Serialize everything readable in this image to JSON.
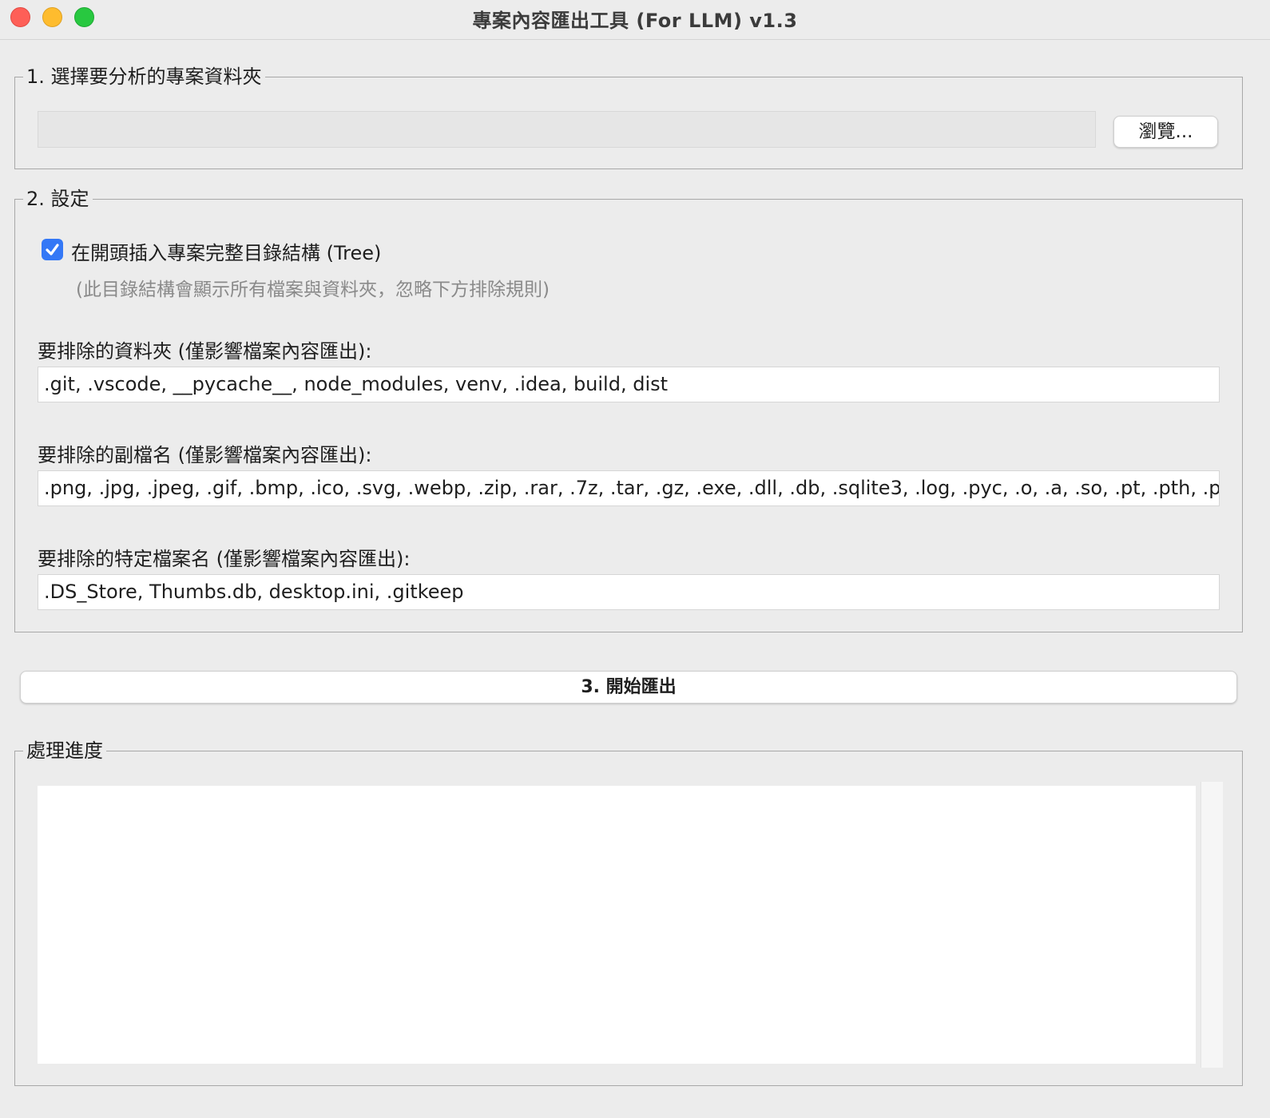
{
  "window": {
    "title": "專案內容匯出工具 (For LLM) v1.3"
  },
  "section1": {
    "legend": "1. 選擇要分析的專案資料夾",
    "path_value": "",
    "browse_label": "瀏覽..."
  },
  "section2": {
    "legend": "2. 設定",
    "tree_checkbox": {
      "checked": true,
      "label": "在開頭插入專案完整目錄結構 (Tree)",
      "hint": "(此目錄結構會顯示所有檔案與資料夾，忽略下方排除規則)"
    },
    "exclude_dirs": {
      "label": "要排除的資料夾 (僅影響檔案內容匯出):",
      "value": ".git, .vscode, __pycache__, node_modules, venv, .idea, build, dist"
    },
    "exclude_exts": {
      "label": "要排除的副檔名 (僅影響檔案內容匯出):",
      "value": ".png, .jpg, .jpeg, .gif, .bmp, .ico, .svg, .webp, .zip, .rar, .7z, .tar, .gz, .exe, .dll, .db, .sqlite3, .log, .pyc, .o, .a, .so, .pt, .pth, .pkl"
    },
    "exclude_files": {
      "label": "要排除的特定檔案名 (僅影響檔案內容匯出):",
      "value": ".DS_Store, Thumbs.db, desktop.ini, .gitkeep"
    }
  },
  "export_button": {
    "label": "3. 開始匯出"
  },
  "progress": {
    "legend": "處理進度",
    "log_text": ""
  },
  "colors": {
    "accent": "#3478f6",
    "window_bg": "#ececec",
    "close": "#fe5f57",
    "minimize": "#febc2e",
    "maximize": "#28c840"
  }
}
